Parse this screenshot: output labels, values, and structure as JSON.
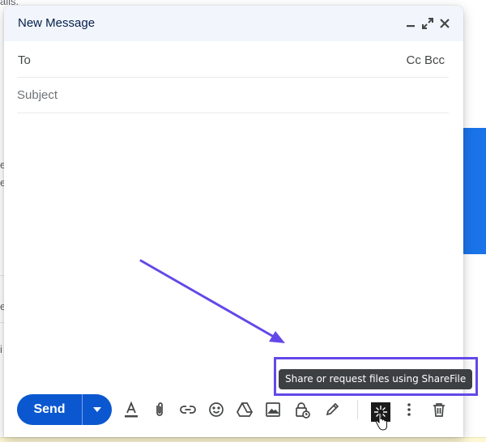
{
  "background": {
    "fragments": [
      "ails.",
      "e",
      "e",
      "e",
      "i"
    ]
  },
  "compose": {
    "title": "New Message",
    "header_icons": [
      "minimize-icon",
      "expand-icon",
      "close-icon"
    ],
    "to_label": "To",
    "cc_bcc_label": "Cc Bcc",
    "subject_placeholder": "Subject",
    "send_label": "Send",
    "toolbar_icons": [
      "text-format-icon",
      "attach-icon",
      "link-icon",
      "emoji-icon",
      "drive-icon",
      "photo-icon",
      "confidential-mode-icon",
      "signature-icon",
      "sharefile-icon",
      "more-options-icon",
      "discard-icon"
    ]
  },
  "tooltip": {
    "text": "Share or request files using ShareFile"
  },
  "colors": {
    "send_button": "#0b57d0",
    "header_bg": "#f2f6fc",
    "annotation": "#6448e8",
    "tooltip_bg": "#3c4043"
  }
}
